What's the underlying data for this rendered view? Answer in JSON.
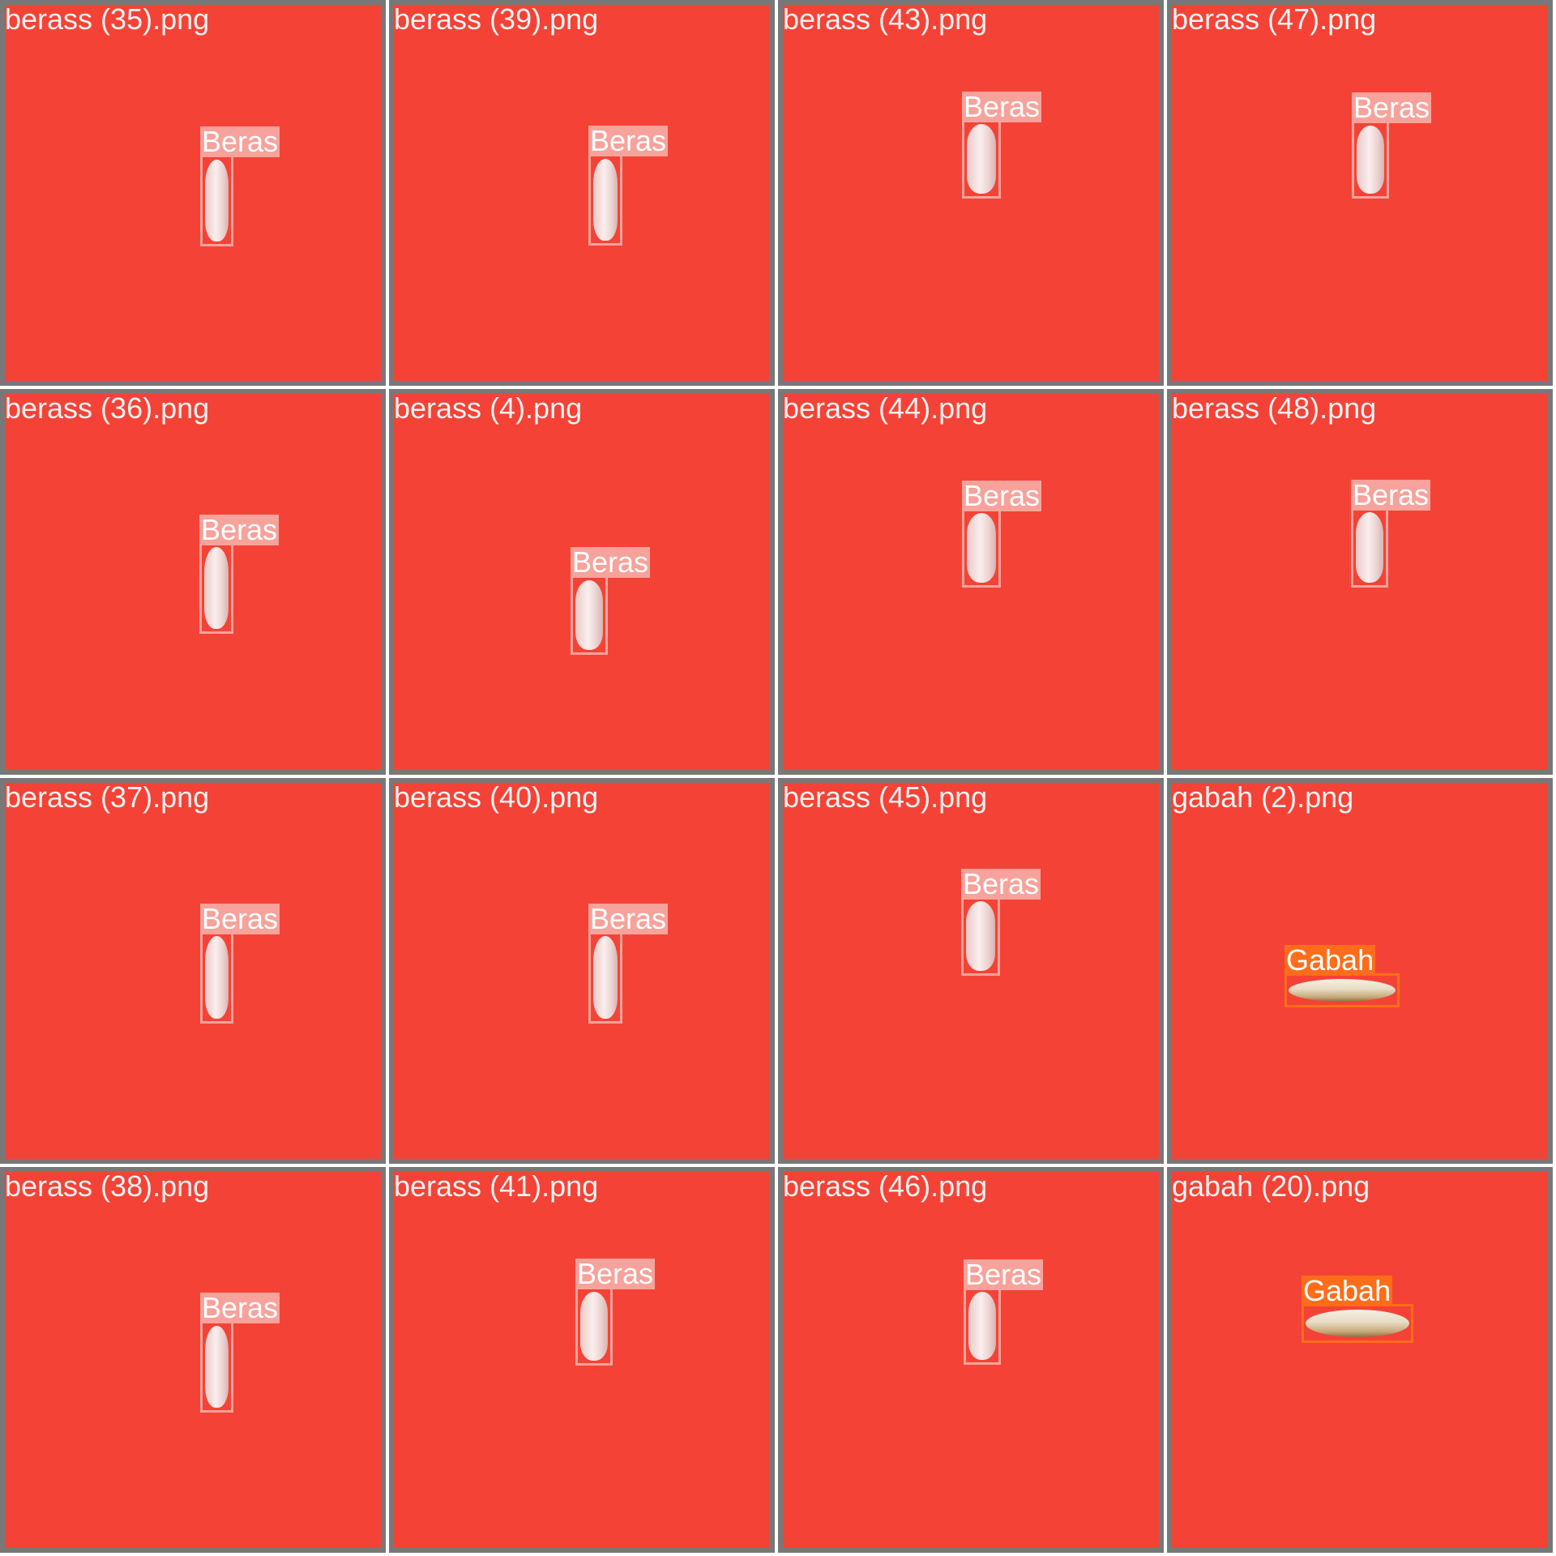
{
  "colors": {
    "tile_background": "#f44336",
    "tile_border": "#787878",
    "beras": "#f7a29b",
    "gabah": "#ff6d1a"
  },
  "tiles": [
    {
      "filename": "berass (35).png",
      "detection": {
        "label": "Beras",
        "class": "beras"
      }
    },
    {
      "filename": "berass (39).png",
      "detection": {
        "label": "Beras",
        "class": "beras"
      }
    },
    {
      "filename": "berass (43).png",
      "detection": {
        "label": "Beras",
        "class": "beras"
      }
    },
    {
      "filename": "berass (47).png",
      "detection": {
        "label": "Beras",
        "class": "beras"
      }
    },
    {
      "filename": "berass (36).png",
      "detection": {
        "label": "Beras",
        "class": "beras"
      }
    },
    {
      "filename": "berass (4).png",
      "detection": {
        "label": "Beras",
        "class": "beras"
      }
    },
    {
      "filename": "berass (44).png",
      "detection": {
        "label": "Beras",
        "class": "beras"
      }
    },
    {
      "filename": "berass (48).png",
      "detection": {
        "label": "Beras",
        "class": "beras"
      }
    },
    {
      "filename": "berass (37).png",
      "detection": {
        "label": "Beras",
        "class": "beras"
      }
    },
    {
      "filename": "berass (40).png",
      "detection": {
        "label": "Beras",
        "class": "beras"
      }
    },
    {
      "filename": "berass (45).png",
      "detection": {
        "label": "Beras",
        "class": "beras"
      }
    },
    {
      "filename": "gabah (2).png",
      "detection": {
        "label": "Gabah",
        "class": "gabah"
      }
    },
    {
      "filename": "berass (38).png",
      "detection": {
        "label": "Beras",
        "class": "beras"
      }
    },
    {
      "filename": "berass (41).png",
      "detection": {
        "label": "Beras",
        "class": "beras"
      }
    },
    {
      "filename": "berass (46).png",
      "detection": {
        "label": "Beras",
        "class": "beras"
      }
    },
    {
      "filename": "gabah (20).png",
      "detection": {
        "label": "Gabah",
        "class": "gabah"
      }
    }
  ]
}
